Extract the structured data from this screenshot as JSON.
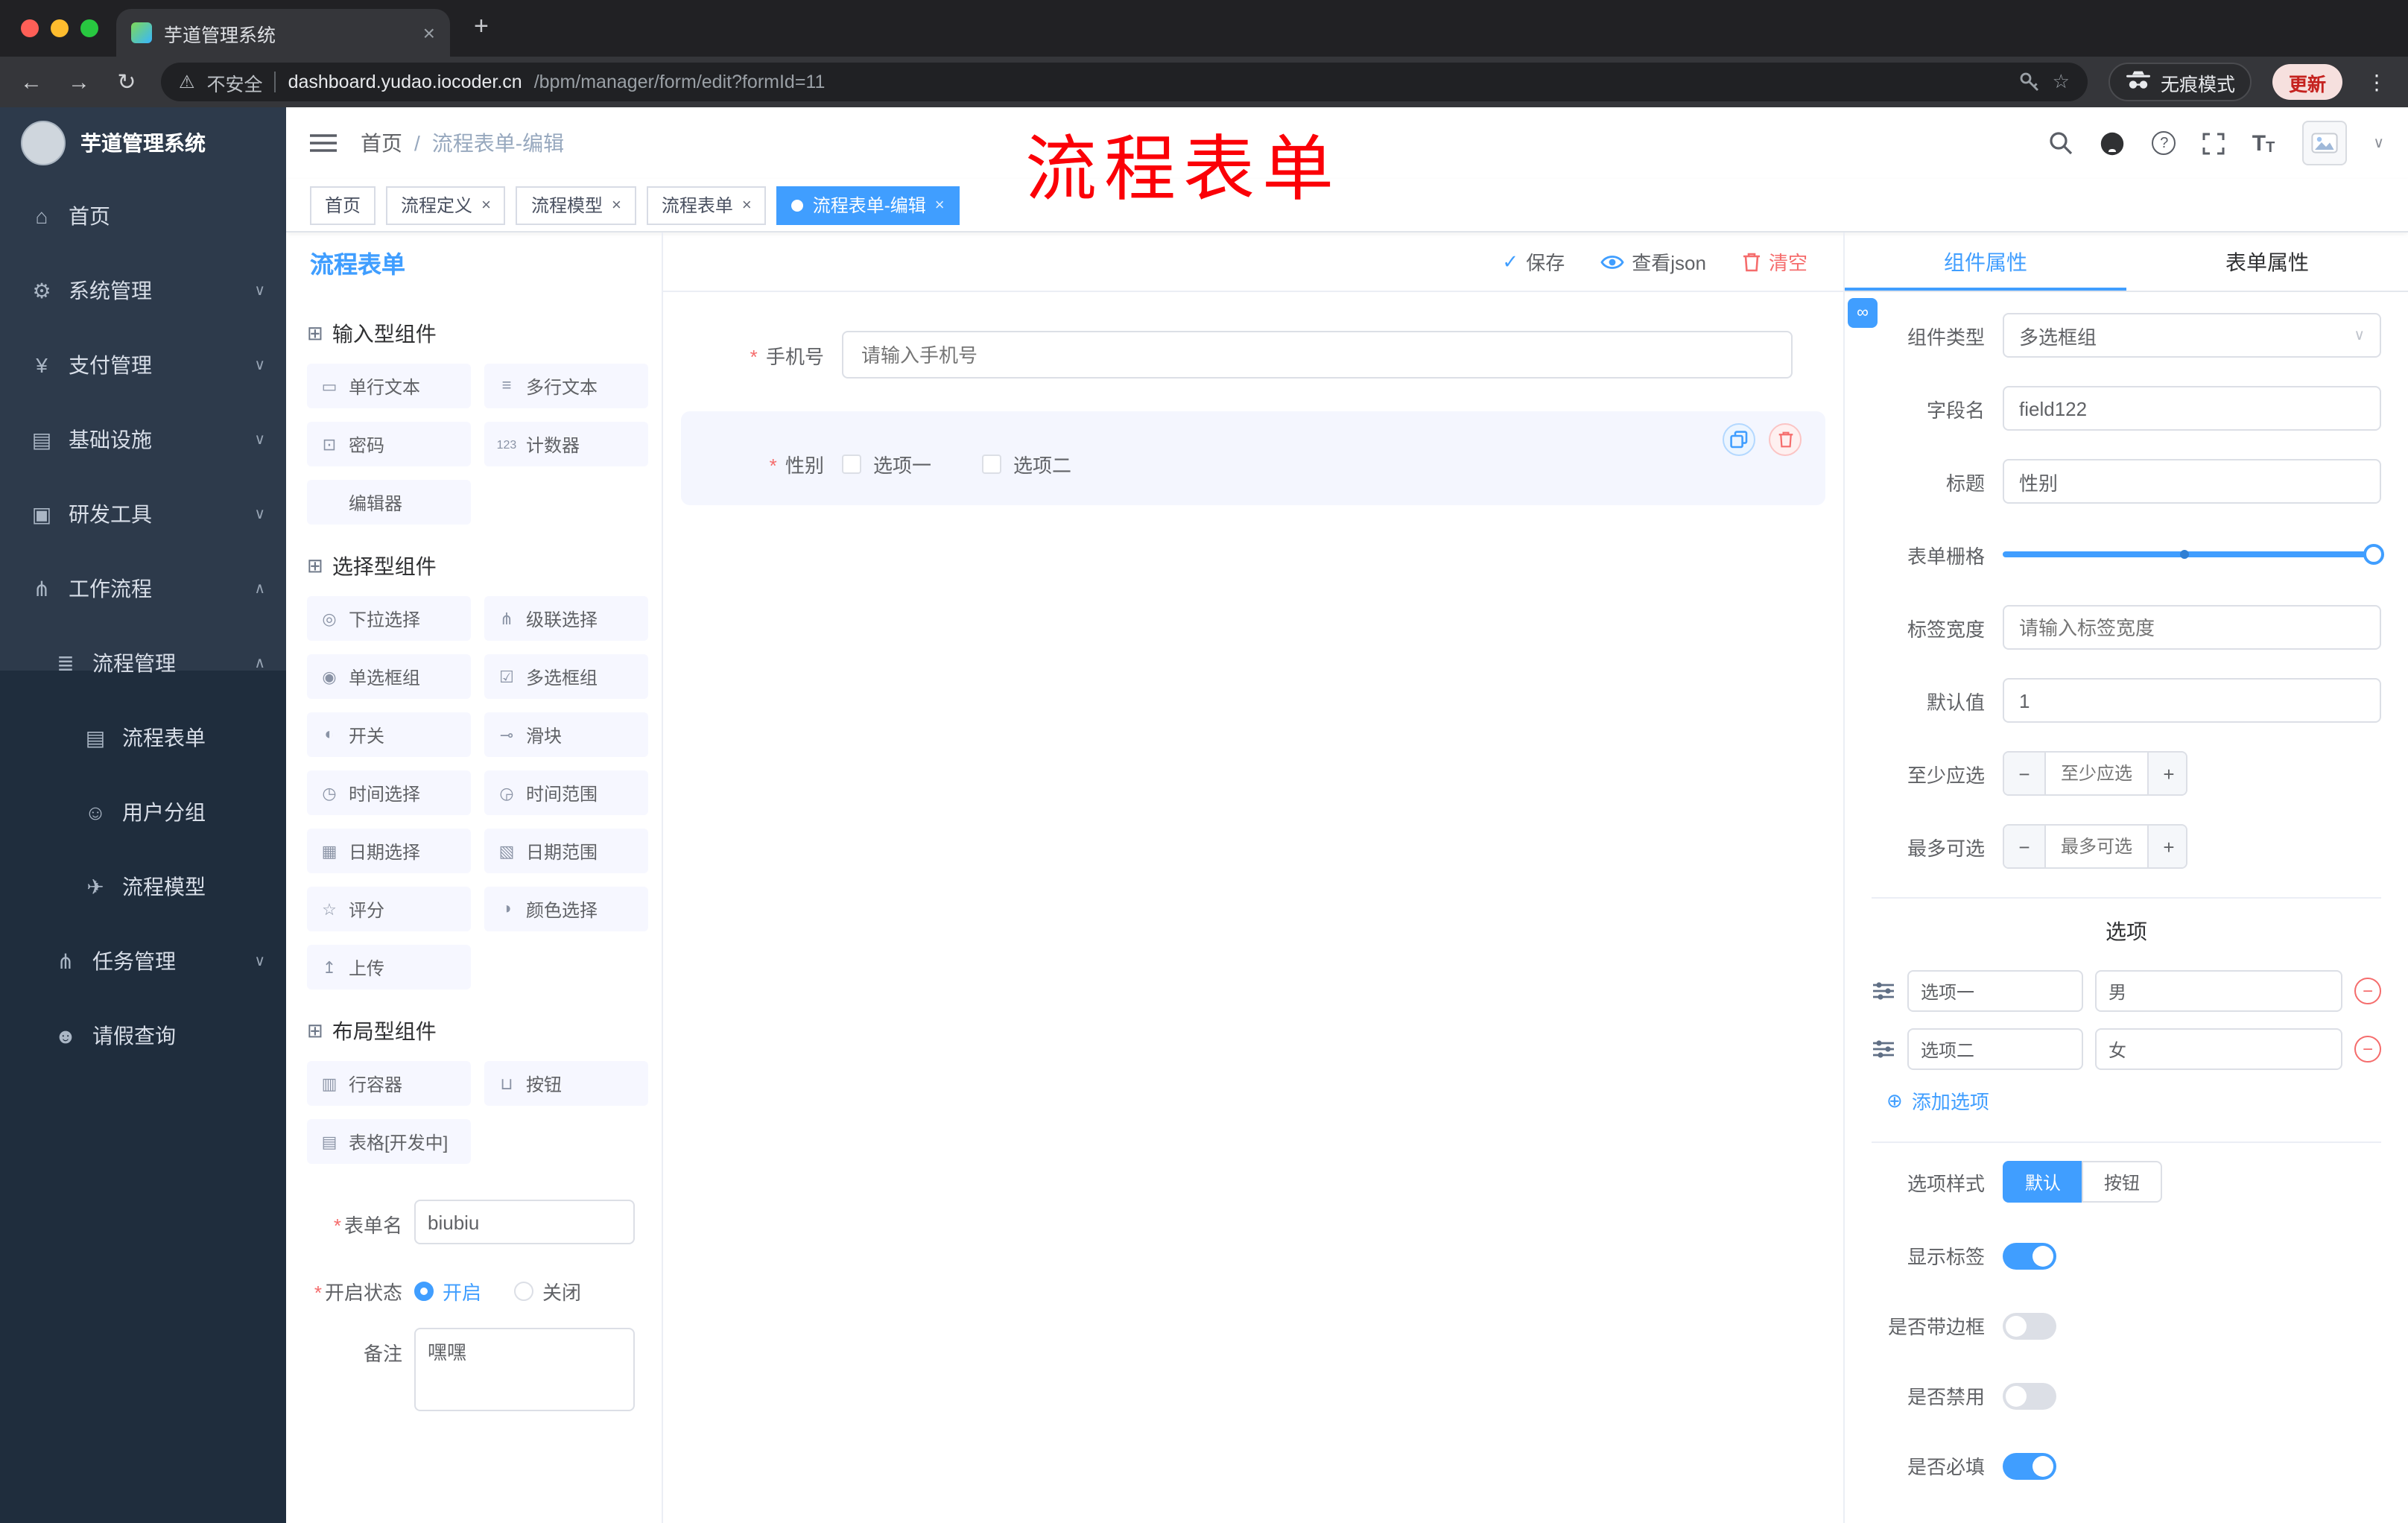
{
  "browser": {
    "tab_title": "芋道管理系统",
    "security_label": "不安全",
    "url_host": "dashboard.yudao.iocoder.cn",
    "url_path": "/bpm/manager/form/edit?formId=11",
    "incognito_label": "无痕模式",
    "update_label": "更新"
  },
  "annotation": {
    "overlay_text": "流程表单"
  },
  "glyphs": {
    "close": "×",
    "new_tab": "+",
    "back": "←",
    "forward": "→",
    "reload": "↻",
    "warning": "⚠",
    "star": "☆",
    "kebab": "⋮",
    "required": "*",
    "check": "✓",
    "slash": "/",
    "chevron_down": "∨",
    "minus": "−",
    "plus": "+",
    "add": "⊕",
    "link": "∞",
    "question": "?",
    "t_large": "T",
    "t_small": "T"
  },
  "sidebar": {
    "logo_title": "芋道管理系统",
    "items": [
      {
        "icon": "⌂",
        "label": "首页",
        "chevron": ""
      },
      {
        "icon": "⚙",
        "label": "系统管理",
        "chevron": "∨"
      },
      {
        "icon": "¥",
        "label": "支付管理",
        "chevron": "∨"
      },
      {
        "icon": "▤",
        "label": "基础设施",
        "chevron": "∨"
      },
      {
        "icon": "▣",
        "label": "研发工具",
        "chevron": "∨"
      },
      {
        "icon": "⋔",
        "label": "工作流程",
        "chevron": "∧"
      },
      {
        "icon": "≣",
        "label": "流程管理",
        "chevron": "∧"
      },
      {
        "icon": "▤",
        "label": "流程表单",
        "chevron": ""
      },
      {
        "icon": "☺",
        "label": "用户分组",
        "chevron": ""
      },
      {
        "icon": "✈",
        "label": "流程模型",
        "chevron": ""
      },
      {
        "icon": "⋔",
        "label": "任务管理",
        "chevron": "∨"
      },
      {
        "icon": "☻",
        "label": "请假查询",
        "chevron": ""
      }
    ]
  },
  "navbar": {
    "breadcrumb_home": "首页",
    "breadcrumb_current": "流程表单-编辑"
  },
  "tags": [
    {
      "label": "首页"
    },
    {
      "label": "流程定义"
    },
    {
      "label": "流程模型"
    },
    {
      "label": "流程表单"
    },
    {
      "label": "流程表单-编辑"
    }
  ],
  "palette": {
    "panel_title": "流程表单",
    "groups": [
      {
        "icon": "⊞",
        "title": "输入型组件",
        "items": [
          {
            "icon": "▭",
            "label": "单行文本"
          },
          {
            "icon": "≡",
            "label": "多行文本"
          },
          {
            "icon": "⊡",
            "label": "密码"
          },
          {
            "icon": "123",
            "label": "计数器"
          },
          {
            "icon": "",
            "label": "编辑器"
          }
        ]
      },
      {
        "icon": "⊞",
        "title": "选择型组件",
        "items": [
          {
            "icon": "◎",
            "label": "下拉选择"
          },
          {
            "icon": "⋔",
            "label": "级联选择"
          },
          {
            "icon": "◉",
            "label": "单选框组"
          },
          {
            "icon": "☑",
            "label": "多选框组"
          },
          {
            "icon": "◐",
            "label": "开关"
          },
          {
            "icon": "⊸",
            "label": "滑块"
          },
          {
            "icon": "◷",
            "label": "时间选择"
          },
          {
            "icon": "◶",
            "label": "时间范围"
          },
          {
            "icon": "▦",
            "label": "日期选择"
          },
          {
            "icon": "▧",
            "label": "日期范围"
          },
          {
            "icon": "☆",
            "label": "评分"
          },
          {
            "icon": "◑",
            "label": "颜色选择"
          },
          {
            "icon": "↥",
            "label": "上传"
          }
        ]
      },
      {
        "icon": "⊞",
        "title": "布局型组件",
        "items": [
          {
            "icon": "▥",
            "label": "行容器"
          },
          {
            "icon": "⊔",
            "label": "按钮"
          },
          {
            "icon": "▤",
            "label": "表格[开发中]"
          }
        ]
      }
    ]
  },
  "meta": {
    "name_label": "表单名",
    "name_value": "biubiu",
    "status_label": "开启状态",
    "status_on": "开启",
    "status_off": "关闭",
    "remark_label": "备注",
    "remark_value": "嘿嘿"
  },
  "toolbar": {
    "save": "保存",
    "view_json": "查看json",
    "clear": "清空"
  },
  "canvas": {
    "phone_label": "手机号",
    "phone_placeholder": "请输入手机号",
    "gender_label": "性别",
    "gender_opt1": "选项一",
    "gender_opt2": "选项二"
  },
  "props": {
    "tab_component": "组件属性",
    "tab_form": "表单属性",
    "component_type_label": "组件类型",
    "component_type_value": "多选框组",
    "field_name_label": "字段名",
    "field_name_value": "field122",
    "title_label": "标题",
    "title_value": "性别",
    "grid_label": "表单栅格",
    "label_width_label": "标签宽度",
    "label_width_placeholder": "请输入标签宽度",
    "default_label": "默认值",
    "default_value": "1",
    "min_label": "至少应选",
    "min_placeholder": "至少应选",
    "max_label": "最多可选",
    "max_placeholder": "最多可选",
    "options_title": "选项",
    "options": [
      {
        "label": "选项一",
        "value": "男"
      },
      {
        "label": "选项二",
        "value": "女"
      }
    ],
    "add_option": "添加选项",
    "option_style_label": "选项样式",
    "style_default": "默认",
    "style_button": "按钮",
    "toggles": [
      {
        "label": "显示标签",
        "on": true
      },
      {
        "label": "是否带边框",
        "on": false
      },
      {
        "label": "是否禁用",
        "on": false
      },
      {
        "label": "是否必填",
        "on": true
      }
    ]
  },
  "colors": {
    "accent": "#409eff",
    "danger": "#f56c6c",
    "sidebar": "#2d3a4b",
    "annotation": "#fb0007"
  }
}
